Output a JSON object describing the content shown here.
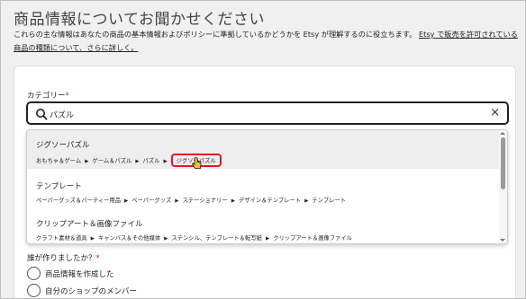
{
  "page": {
    "title": "商品情報についてお聞かせください",
    "intro_text": "これらの主な情報はあなたの商品の基本情報およびポリシーに準拠しているかどうかを Etsy が理解するのに役立ちます。",
    "intro_link": "Etsy で販売を許可されている商品の種類について、さらに詳しく。"
  },
  "category": {
    "label": "カテゴリー",
    "required_mark": "*",
    "search_value": "パズル",
    "clear_icon": "×"
  },
  "dropdown": {
    "options": [
      {
        "title": "ジグソーパズル",
        "path": [
          "おもちゃ＆ゲーム",
          "ゲーム＆パズル",
          "パズル",
          "ジグソーパズル"
        ],
        "highlighted": true
      },
      {
        "title": "テンプレート",
        "path": [
          "ペーパーグッズ＆パーティー用品",
          "ペーパーグッズ",
          "ステーショナリー",
          "デザイン＆テンプレート",
          "テンプレート"
        ],
        "highlighted": false
      },
      {
        "title": "クリップアート＆画像ファイル",
        "path": [
          "クラフト素材＆道具",
          "キャンバス＆その他媒体",
          "ステンシル、テンプレート＆転写紙",
          "クリップアート＆画像ファイル"
        ],
        "highlighted": false
      }
    ]
  },
  "who_made": {
    "label": "誰が作りましたか？",
    "required_mark": "*",
    "options": [
      "商品情報を作成した",
      "自分のショップのメンバー"
    ]
  },
  "colors": {
    "accent_red": "#e0191f",
    "background": "#f0f0f0"
  },
  "icons": {
    "search": "search-icon",
    "cursor": "pointer-hand-icon",
    "clear": "close-icon",
    "breadcrumb_separator": "triangle-right-icon"
  }
}
